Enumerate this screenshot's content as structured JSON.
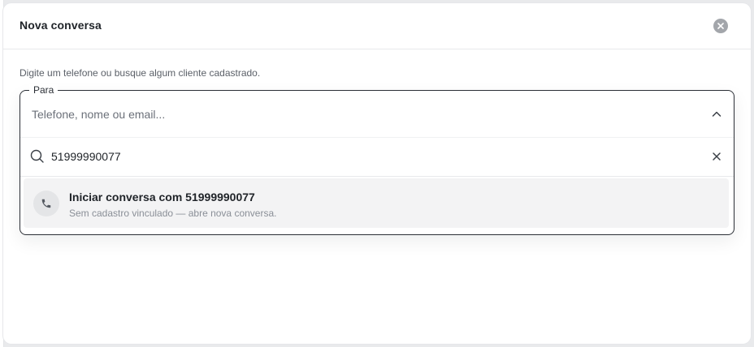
{
  "dialog": {
    "title": "Nova conversa",
    "close_icon": "close-icon"
  },
  "hint": "Digite um telefone ou busque algum cliente cadastrado.",
  "to_field": {
    "legend": "Para",
    "placeholder": "Telefone, nome ou email...",
    "chevron_icon": "chevron-up-icon"
  },
  "search": {
    "value": "51999990077",
    "search_icon": "search-icon",
    "clear_icon": "clear-icon"
  },
  "options": [
    {
      "icon": "phone-icon",
      "title": "Iniciar conversa com 51999990077",
      "subtitle": "Sem cadastro vinculado — abre nova conversa."
    }
  ],
  "colors": {
    "border_active": "#2b2f36",
    "option_bg": "#f3f3f4",
    "close_bg": "#a3a6ab"
  }
}
